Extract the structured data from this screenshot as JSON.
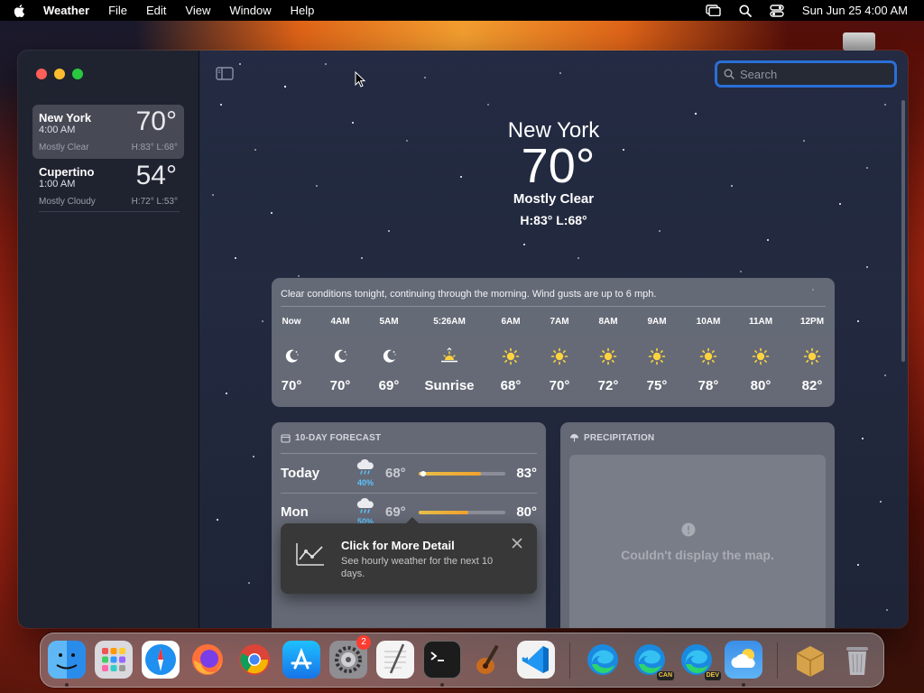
{
  "menubar": {
    "app_name": "Weather",
    "menus": [
      "File",
      "Edit",
      "View",
      "Window",
      "Help"
    ],
    "clock": "Sun Jun 25  4:00 AM"
  },
  "sidebar": {
    "cities": [
      {
        "name": "New York",
        "time": "4:00 AM",
        "temp": "70°",
        "condition": "Mostly Clear",
        "hilo": "H:83°  L:68°"
      },
      {
        "name": "Cupertino",
        "time": "1:00 AM",
        "temp": "54°",
        "condition": "Mostly Cloudy",
        "hilo": "H:72°  L:53°"
      }
    ]
  },
  "search": {
    "placeholder": "Search"
  },
  "current": {
    "city": "New York",
    "temp": "70°",
    "condition": "Mostly Clear",
    "hilo": "H:83°  L:68°"
  },
  "hourly": {
    "summary": "Clear conditions tonight, continuing through the morning. Wind gusts are up to 6 mph.",
    "hours": [
      {
        "label": "Now",
        "icon": "moon-icon",
        "temp": "70°"
      },
      {
        "label": "4AM",
        "icon": "moon-icon",
        "temp": "70°"
      },
      {
        "label": "5AM",
        "icon": "moon-icon",
        "temp": "69°"
      },
      {
        "label": "5:26AM",
        "icon": "sunrise-icon",
        "temp": "Sunrise"
      },
      {
        "label": "6AM",
        "icon": "sun-icon",
        "temp": "68°"
      },
      {
        "label": "7AM",
        "icon": "sun-icon",
        "temp": "70°"
      },
      {
        "label": "8AM",
        "icon": "sun-icon",
        "temp": "72°"
      },
      {
        "label": "9AM",
        "icon": "sun-icon",
        "temp": "75°"
      },
      {
        "label": "10AM",
        "icon": "sun-icon",
        "temp": "78°"
      },
      {
        "label": "11AM",
        "icon": "sun-icon",
        "temp": "80°"
      },
      {
        "label": "12PM",
        "icon": "sun-icon",
        "temp": "82°"
      }
    ]
  },
  "forecast": {
    "heading": "10-DAY FORECAST",
    "days": [
      {
        "day": "Today",
        "icon": "cloud-rain-icon",
        "chance": "40%",
        "low": "68°",
        "high": "83°",
        "range_low": 0.0,
        "range_high": 0.72,
        "current_marker": 0.05
      },
      {
        "day": "Mon",
        "icon": "cloud-rain-icon",
        "chance": "50%",
        "low": "69°",
        "high": "80°",
        "range_low": 0.0,
        "range_high": 0.57
      }
    ]
  },
  "precipitation": {
    "heading": "PRECIPITATION",
    "message": "Couldn't display the map."
  },
  "tooltip": {
    "title": "Click for More Detail",
    "body": "See hourly weather for the next 10 days."
  },
  "dock": {
    "apps": [
      "Finder",
      "Launchpad",
      "Safari",
      "Firefox",
      "Chrome",
      "App Store",
      "System Settings",
      "TextEdit",
      "Terminal",
      "GarageBand",
      "Visual Studio Code",
      "Microsoft Edge",
      "Microsoft Edge Canary",
      "Microsoft Edge Dev",
      "Weather",
      "Downloads",
      "Trash"
    ],
    "settings_badge": "2",
    "edge_canary_tag": "CAN",
    "edge_dev_tag": "DEV"
  }
}
